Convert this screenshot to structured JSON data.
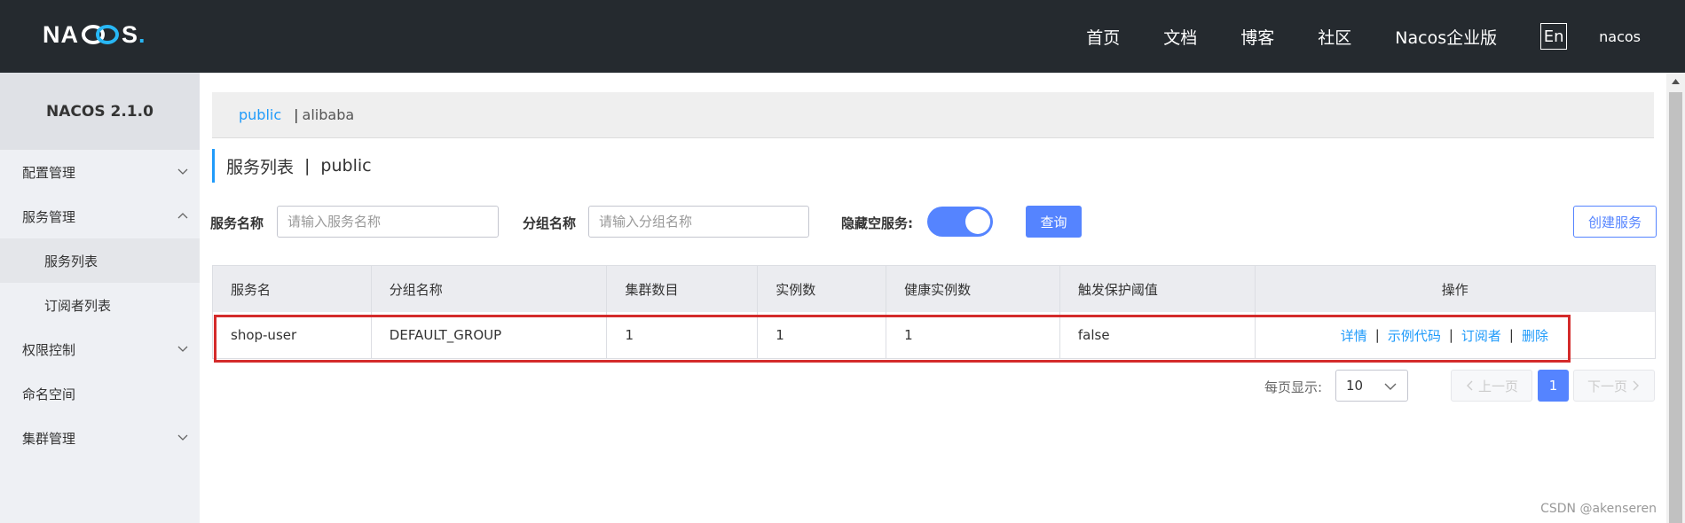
{
  "header": {
    "logo_text_left": "NA",
    "logo_text_right": "S",
    "logo_dot": ".",
    "nav": [
      "首页",
      "文档",
      "博客",
      "社区",
      "Nacos企业版"
    ],
    "lang": "En",
    "user": "nacos"
  },
  "sidebar": {
    "title": "NACOS 2.1.0",
    "items": [
      {
        "label": "配置管理",
        "icon": "chevron-down-icon"
      },
      {
        "label": "服务管理",
        "icon": "chevron-up-icon"
      },
      {
        "label": "服务列表"
      },
      {
        "label": "订阅者列表"
      },
      {
        "label": "权限控制",
        "icon": "chevron-down-icon"
      },
      {
        "label": "命名空间"
      },
      {
        "label": "集群管理",
        "icon": "chevron-down-icon"
      }
    ]
  },
  "namespace": {
    "active": "public",
    "separator": "|",
    "other": "alibaba"
  },
  "heading": {
    "title": "服务列表",
    "separator": "|",
    "namespace": "public"
  },
  "filters": {
    "service_name_label": "服务名称",
    "service_name_placeholder": "请输入服务名称",
    "group_name_label": "分组名称",
    "group_name_placeholder": "请输入分组名称",
    "hide_empty_label": "隐藏空服务:",
    "hide_empty_on": true,
    "query_button": "查询",
    "create_button": "创建服务"
  },
  "table": {
    "columns": [
      "服务名",
      "分组名称",
      "集群数目",
      "实例数",
      "健康实例数",
      "触发保护阈值",
      "操作"
    ],
    "rows": [
      {
        "service": "shop-user",
        "group": "DEFAULT_GROUP",
        "clusters": "1",
        "instances": "1",
        "healthy": "1",
        "threshold": "false",
        "actions": [
          "详情",
          "示例代码",
          "订阅者",
          "删除"
        ],
        "action_separator": "|"
      }
    ]
  },
  "pagination": {
    "page_size_label": "每页显示:",
    "page_size": "10",
    "prev": "上一页",
    "current": "1",
    "next": "下一页"
  },
  "watermark": "CSDN @akenseren",
  "colors": {
    "header_bg": "#252a2f",
    "accent": "#5584ff",
    "link": "#209bfa",
    "highlight": "#d42b2b"
  }
}
